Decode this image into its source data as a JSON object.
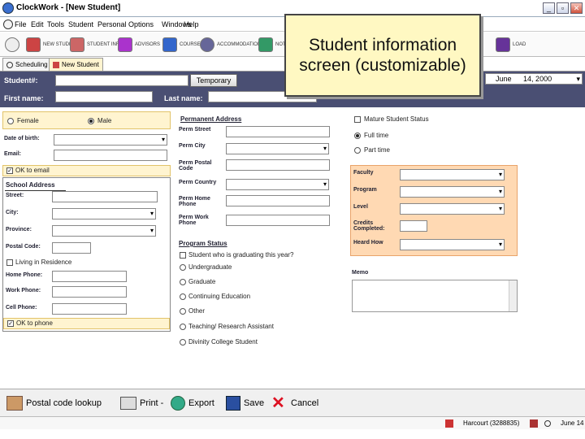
{
  "window": {
    "title": "ClockWork - [New Student]",
    "controls": [
      "_",
      "▫",
      "✕"
    ]
  },
  "menu": [
    "File",
    "Edit",
    "Tools",
    "Student",
    "Personal Options",
    "Windows",
    "Help"
  ],
  "toolbar": [
    {
      "label": "NEW STUDENT",
      "icon": "person-add-icon",
      "color": "#c44"
    },
    {
      "label": "STUDENT INFO",
      "icon": "student-icon",
      "color": "#c66"
    },
    {
      "label": "ADVISORS",
      "icon": "advisor-icon",
      "color": "#a3c"
    },
    {
      "label": "COURSES",
      "icon": "courses-icon",
      "color": "#36c"
    },
    {
      "label": "ACCOMMODATIONS",
      "icon": "accommodations-icon",
      "color": "#669"
    },
    {
      "label": "NOTES",
      "icon": "notes-icon",
      "color": "#396"
    },
    {
      "label": "LOAD",
      "icon": "load-icon",
      "color": "#639"
    }
  ],
  "tabs": [
    {
      "label": "Scheduling",
      "active": false
    },
    {
      "label": "New Student",
      "active": true
    }
  ],
  "header": {
    "student_label": "Student#:",
    "student_value": "",
    "temporary_button": "Temporary",
    "first_name_label": "First name:",
    "last_name_label": "Last name:",
    "date_month": "June",
    "date_day": "14, 2000"
  },
  "callout": {
    "line1": "Student information",
    "line2": "screen (customizable)"
  },
  "gender": {
    "female": "Female",
    "male": "Male",
    "selected": "male"
  },
  "left_fields": {
    "dob_label": "Date of birth:",
    "email_label": "Email:",
    "ok_email": "OK to email",
    "school_address_title": "School Address",
    "street_label": "Street:",
    "city_label": "City:",
    "province_label": "Province:",
    "postal_label": "Postal Code:",
    "living_residence": "Living in Residence",
    "home_phone_label": "Home Phone:",
    "work_phone_label": "Work Phone:",
    "cell_phone_label": "Cell Phone:",
    "ok_phone": "OK to phone"
  },
  "permanent": {
    "title": "Permanent Address",
    "street": "Perm Street",
    "city": "Perm City",
    "postal_1": "Perm Postal",
    "postal_2": "Code",
    "country": "Perm Country",
    "home_1": "Perm Home",
    "home_2": "Phone",
    "work_1": "Perm Work",
    "work_2": "Phone"
  },
  "program_status": {
    "title": "Program Status",
    "graduating": "Student who is graduating this year?",
    "options": [
      "Undergraduate",
      "Graduate",
      "Continuing Education",
      "Other",
      "Teaching/ Research Assistant",
      "Divinity College Student"
    ]
  },
  "enrolment": {
    "mature": "Mature Student Status",
    "full_time": "Full time",
    "part_time": "Part time",
    "selected": "full_time"
  },
  "academic": {
    "faculty": "Faculty",
    "program": "Program",
    "level": "Level",
    "credits_1": "Credits",
    "credits_2": "Completed:",
    "heard_how": "Heard How"
  },
  "memo_label": "Memo",
  "bottom_buttons": [
    {
      "label": "Postal code lookup",
      "icon": "lookup-icon"
    },
    {
      "label": "Print -",
      "icon": "printer-icon"
    },
    {
      "label": "Export",
      "icon": "export-icon"
    },
    {
      "label": "Save",
      "icon": "save-icon"
    },
    {
      "label": "Cancel",
      "icon": "cancel-icon"
    }
  ],
  "status": {
    "user": "Harcourt (3288835)",
    "date": "June 14"
  },
  "colors": {
    "header_band": "#4a4f73",
    "yellow_panel": "#fff4d0",
    "orange_panel": "#ffd9b3",
    "callout_bg": "#fff8c2"
  }
}
